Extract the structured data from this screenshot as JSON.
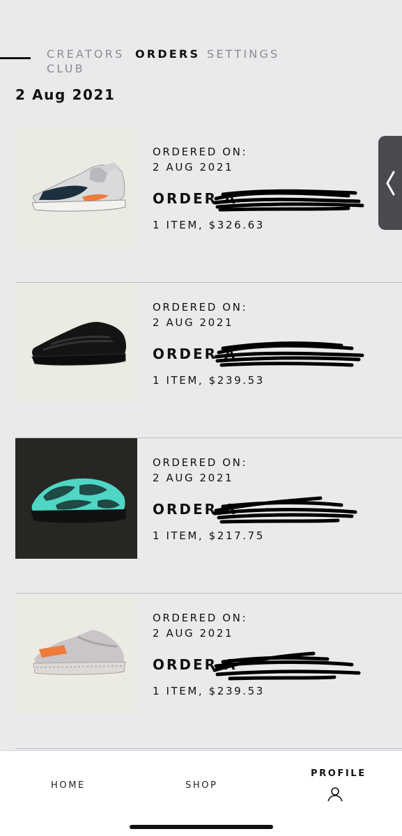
{
  "tabs": [
    {
      "label": "CREATORS CLUB",
      "active": false
    },
    {
      "label": "ORDERS",
      "active": true
    },
    {
      "label": "SETTINGS",
      "active": false
    }
  ],
  "date_heading": "2 Aug 2021",
  "orders": [
    {
      "ordered_label": "ORDERED ON:",
      "ordered_date": "2 AUG 2021",
      "order_title": "ORDER A",
      "summary": "1 ITEM, $326.63",
      "product_icon": "yeezy-700-wave-runner-shoe-icon"
    },
    {
      "ordered_label": "ORDERED ON:",
      "ordered_date": "2 AUG 2021",
      "order_title": "ORDER A",
      "summary": "1 ITEM, $239.53",
      "product_icon": "yeezy-700-black-shoe-icon"
    },
    {
      "ordered_label": "ORDERED ON:",
      "ordered_date": "2 AUG 2021",
      "order_title": "ORDER A",
      "summary": "1 ITEM, $217.75",
      "product_icon": "yeezy-700-v3-glow-shoe-icon"
    },
    {
      "ordered_label": "ORDERED ON:",
      "ordered_date": "2 AUG 2021",
      "order_title": "ORDER A",
      "summary": "1 ITEM, $239.53",
      "product_icon": "yeezy-350-v2-shoe-icon"
    }
  ],
  "bottom_nav": {
    "home": "HOME",
    "shop": "SHOP",
    "profile": "PROFILE"
  },
  "colors": {
    "background": "#e9eaec",
    "text": "#111111",
    "inactive_tab": "#8a8c90",
    "divider": "#bdbec2",
    "handle": "#4a4b4f",
    "accent_orange": "#f07a3a",
    "glow_teal": "#4fd6c4"
  }
}
